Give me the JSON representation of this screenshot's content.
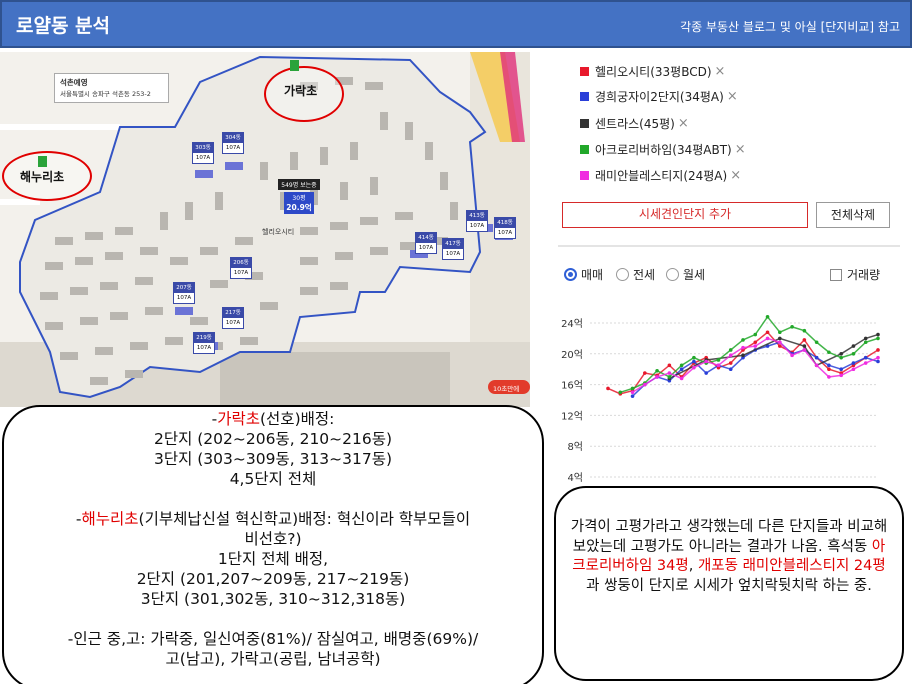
{
  "header": {
    "title": "로얄동 분석",
    "subtitle": "각종 부동산 블로그 및 아실 [단지비교] 참고",
    "color": "#4472c4"
  },
  "map": {
    "info_card": {
      "title": "석촌예영",
      "address": "서울특별시 송파구 석촌동 253-2"
    },
    "circles": [
      {
        "label": "가락초"
      },
      {
        "label": "해누리초"
      }
    ],
    "dong_tags": [
      {
        "dong": "303동",
        "type": "107A"
      },
      {
        "dong": "304동",
        "type": "107A"
      },
      {
        "dong": "207동",
        "type": "107A"
      },
      {
        "dong": "206동",
        "type": "107A"
      },
      {
        "dong": "217동",
        "type": "107A"
      },
      {
        "dong": "219동",
        "type": "107A"
      },
      {
        "dong": "414동",
        "type": "107A"
      },
      {
        "dong": "417동",
        "type": "107A"
      },
      {
        "dong": "413동",
        "type": "107A"
      },
      {
        "dong": "418동",
        "type": "107A"
      }
    ],
    "price_marker": {
      "label": "549명 보는중",
      "area": "30평",
      "price": "20.9억"
    },
    "labels": [
      "헬리오시티",
      "10초만에"
    ]
  },
  "info_left": {
    "lines": [
      {
        "pre": "-",
        "red": "가락초",
        "post": "(선호)배정:"
      },
      {
        "pre": "2단지 (202~206동, 210~216동)",
        "red": "",
        "post": ""
      },
      {
        "pre": "3단지 (303~309동, 313~317동)",
        "red": "",
        "post": ""
      },
      {
        "pre": "4,5단지 전체",
        "red": "",
        "post": ""
      },
      {
        "gap": true
      },
      {
        "pre": "-",
        "red": "해누리초",
        "post": "(기부체납신설 혁신학교)배정: 혁신이라 학부모들이"
      },
      {
        "pre": "비선호?)",
        "red": "",
        "post": ""
      },
      {
        "pre": "1단지 전체 배정,",
        "red": "",
        "post": ""
      },
      {
        "pre": "2단지 (201,207~209동, 217~219동)",
        "red": "",
        "post": ""
      },
      {
        "pre": "3단지 (301,302동, 310~312,318동)",
        "red": "",
        "post": ""
      },
      {
        "gap": true
      },
      {
        "pre": "-인근 중,고: 가락중, 일신여중(81%)/ 잠실여고, 배명중(69%)/",
        "red": "",
        "post": ""
      },
      {
        "pre": "고(남고), 가락고(공립, 남녀공학)",
        "red": "",
        "post": ""
      }
    ]
  },
  "panel": {
    "legend": [
      {
        "label": "헬리오시티(33평BCD)",
        "color": "#e8192c"
      },
      {
        "label": "경희궁자이2단지(34평A)",
        "color": "#2a3fd8"
      },
      {
        "label": "센트라스(45평)",
        "color": "#333333"
      },
      {
        "label": "아크로리버하임(34평ABT)",
        "color": "#22a82a"
      },
      {
        "label": "래미안블레스티지(24평A)",
        "color": "#f02ce0"
      }
    ],
    "remove_icon": "×",
    "add_button": "시세견인단지 추가",
    "delete_all_button": "전체삭제",
    "radios": [
      {
        "label": "매매",
        "selected": true
      },
      {
        "label": "전세",
        "selected": false
      },
      {
        "label": "월세",
        "selected": false
      }
    ],
    "checkbox_label": "거래량"
  },
  "chart_data": {
    "type": "line",
    "y_ticks": [
      "24억",
      "20억",
      "16억",
      "12억",
      "8억",
      "4억"
    ],
    "ylim": [
      4,
      24
    ],
    "grid": true,
    "series": [
      {
        "name": "헬리오시티(33평BCD)",
        "color": "#e8192c",
        "values": [
          15.5,
          14.8,
          15.2,
          17.5,
          17.2,
          18.5,
          17.0,
          18.8,
          19.5,
          18.2,
          18.8,
          20.5,
          21.5,
          22.8,
          21.0,
          20.2,
          21.8,
          19.5,
          18.0,
          17.5,
          18.5,
          19.5,
          20.5
        ]
      },
      {
        "name": "경희궁자이2단지(34평A)",
        "color": "#2a3fd8",
        "values": [
          null,
          null,
          14.5,
          16.0,
          17.0,
          16.5,
          18.0,
          19.0,
          17.5,
          18.5,
          18.0,
          19.5,
          20.5,
          21.0,
          21.5,
          20.0,
          20.5,
          19.5,
          18.5,
          18.0,
          18.8,
          19.5,
          19.0
        ]
      },
      {
        "name": "센트라스(45평)",
        "color": "#333333",
        "values": [
          null,
          null,
          null,
          null,
          null,
          16.8,
          null,
          null,
          19.2,
          null,
          null,
          19.8,
          null,
          null,
          22.0,
          null,
          21.0,
          18.5,
          null,
          20.0,
          21.0,
          22.0,
          22.5
        ]
      },
      {
        "name": "아크로리버하임(34평ABT)",
        "color": "#22a82a",
        "values": [
          null,
          15.0,
          15.5,
          16.2,
          17.8,
          17.0,
          18.5,
          19.5,
          18.8,
          19.2,
          20.5,
          21.8,
          22.5,
          24.8,
          22.8,
          23.5,
          23.0,
          21.5,
          20.2,
          19.5,
          20.0,
          21.5,
          22.0
        ]
      },
      {
        "name": "래미안블레스티지(24평A)",
        "color": "#f02ce0",
        "values": [
          null,
          null,
          15.0,
          16.0,
          17.0,
          17.5,
          16.8,
          18.2,
          19.0,
          18.5,
          19.8,
          20.8,
          21.0,
          22.0,
          21.5,
          19.8,
          20.5,
          18.5,
          17.0,
          17.2,
          18.0,
          18.8,
          19.5
        ]
      }
    ]
  },
  "info_right": {
    "segments": [
      {
        "text": "가격이 고평가라고 생각했는데 다른 단지들과 비교해보았는데 고평가도 아니라는 결과가 나옴. 흑석동 ",
        "red": false
      },
      {
        "text": "아크로리버하임 34평",
        "red": true
      },
      {
        "text": ", ",
        "red": false
      },
      {
        "text": "개포동 래미안블레스티지 24평",
        "red": true
      },
      {
        "text": "과 쌍둥이 단지로 시세가 엎치락뒷치락 하는 중.",
        "red": false
      }
    ]
  }
}
